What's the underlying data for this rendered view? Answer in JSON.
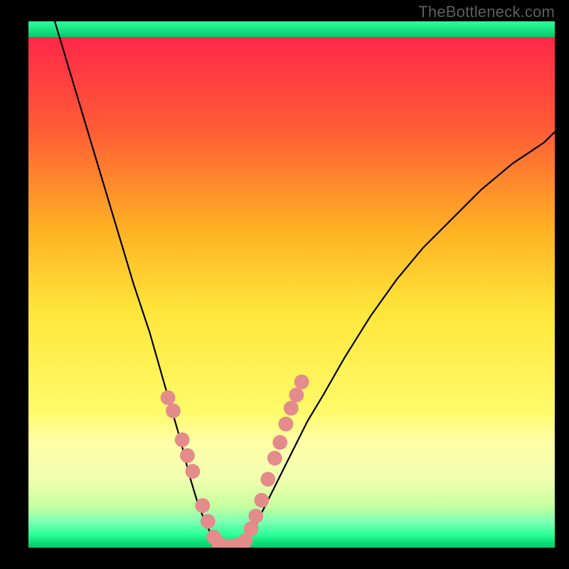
{
  "watermark": "TheBottleneck.com",
  "chart_data": {
    "type": "line",
    "title": "",
    "xlabel": "",
    "ylabel": "",
    "xlim": [
      0,
      100
    ],
    "ylim": [
      0,
      100
    ],
    "grid": false,
    "legend": false,
    "background_gradient_stops": [
      {
        "offset": 0,
        "color": "#ff1f4c"
      },
      {
        "offset": 20,
        "color": "#ff5a36"
      },
      {
        "offset": 40,
        "color": "#ffb324"
      },
      {
        "offset": 55,
        "color": "#ffe63b"
      },
      {
        "offset": 74,
        "color": "#fffb6a"
      },
      {
        "offset": 80,
        "color": "#ffffa8"
      },
      {
        "offset": 87,
        "color": "#f0ffb0"
      },
      {
        "offset": 92,
        "color": "#c8ff9e"
      },
      {
        "offset": 95,
        "color": "#7fffb4"
      },
      {
        "offset": 97.5,
        "color": "#2eff9a"
      },
      {
        "offset": 99,
        "color": "#0bdf7a"
      },
      {
        "offset": 100,
        "color": "#05c96b"
      }
    ],
    "bottom_green_band": {
      "from": 97,
      "to": 100,
      "color_top": "#2eff9a",
      "color_bottom": "#05c96b"
    },
    "series": [
      {
        "name": "left_branch",
        "x": [
          5,
          8,
          11,
          14,
          17,
          20,
          23,
          25,
          27,
          29,
          30.5,
          32,
          33.5,
          34.5,
          35.2,
          36.0,
          36.5
        ],
        "y": [
          100,
          90,
          80,
          70,
          60,
          50,
          41,
          34,
          27,
          20,
          14,
          9,
          5,
          3,
          1.6,
          0.8,
          0.4
        ]
      },
      {
        "name": "valley",
        "x": [
          36.5,
          37.5,
          38.5,
          40.0
        ],
        "y": [
          0.4,
          0.2,
          0.2,
          0.4
        ]
      },
      {
        "name": "right_branch",
        "x": [
          40.0,
          41.5,
          43,
          45,
          47.5,
          50,
          53,
          56,
          60,
          65,
          70,
          75,
          80,
          86,
          92,
          98,
          100
        ],
        "y": [
          0.4,
          1.5,
          4,
          8,
          13,
          18,
          24,
          29,
          36,
          44,
          51,
          57,
          62,
          68,
          73,
          77,
          79
        ]
      }
    ],
    "markers": {
      "color": "#e48b8b",
      "radius_units": 1.4,
      "left_points": [
        {
          "x": 26.5,
          "y": 28.5
        },
        {
          "x": 27.5,
          "y": 26
        },
        {
          "x": 29.2,
          "y": 20.5
        },
        {
          "x": 30.2,
          "y": 17.5
        },
        {
          "x": 31.2,
          "y": 14.5
        },
        {
          "x": 33.1,
          "y": 8
        },
        {
          "x": 34.1,
          "y": 5
        },
        {
          "x": 35.2,
          "y": 2
        }
      ],
      "bottom_points": [
        {
          "x": 36.2,
          "y": 0.7
        },
        {
          "x": 37.3,
          "y": 0.3
        },
        {
          "x": 38.6,
          "y": 0.3
        },
        {
          "x": 39.8,
          "y": 0.5
        }
      ],
      "right_points": [
        {
          "x": 41.2,
          "y": 1.3
        },
        {
          "x": 42.3,
          "y": 3.6
        },
        {
          "x": 43.2,
          "y": 6
        },
        {
          "x": 44.3,
          "y": 9
        },
        {
          "x": 45.5,
          "y": 13
        },
        {
          "x": 46.8,
          "y": 17
        },
        {
          "x": 47.8,
          "y": 20
        },
        {
          "x": 48.9,
          "y": 23.5
        },
        {
          "x": 49.9,
          "y": 26.5
        },
        {
          "x": 50.9,
          "y": 29
        },
        {
          "x": 51.9,
          "y": 31.5
        }
      ]
    }
  }
}
